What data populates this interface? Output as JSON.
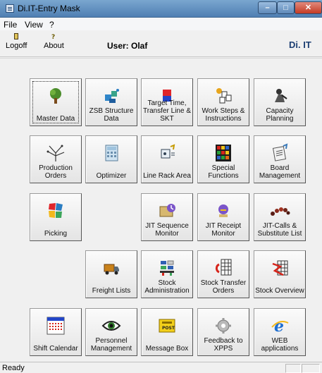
{
  "window": {
    "title": "Di.IT-Entry Mask"
  },
  "menu": {
    "items": [
      "File",
      "View",
      "?"
    ]
  },
  "toolbar": {
    "logoff_label": "Logoff",
    "about_label": "About",
    "user_text": "User:  Olaf",
    "logo_text": "Di. IT"
  },
  "tiles": [
    {
      "label": "Master Data",
      "icon": "tree-icon"
    },
    {
      "label": "ZSB Structure Data",
      "icon": "structure-icon"
    },
    {
      "label": "Target Time, Transfer Line & SKT",
      "icon": "target-time-icon"
    },
    {
      "label": "Work Steps & Instructions",
      "icon": "work-steps-icon"
    },
    {
      "label": "Capacity Planning",
      "icon": "capacity-icon"
    },
    {
      "label": "Production Orders",
      "icon": "production-tree-icon"
    },
    {
      "label": "Optimizer",
      "icon": "calculator-icon"
    },
    {
      "label": "Line Rack Area",
      "icon": "rack-icon"
    },
    {
      "label": "Special Functions",
      "icon": "rubiks-cube-icon"
    },
    {
      "label": "Board Management",
      "icon": "board-icon"
    },
    {
      "label": "Picking",
      "icon": "picking-icon"
    },
    {
      "label": "JIT Sequence Monitor",
      "icon": "jit-sequence-icon"
    },
    {
      "label": "JIT Receipt Monitor",
      "icon": "jit-receipt-icon"
    },
    {
      "label": "JIT-Calls & Substitute List",
      "icon": "jit-calls-icon"
    },
    {
      "label": "Freight Lists",
      "icon": "truck-icon"
    },
    {
      "label": "Stock Administration",
      "icon": "stock-admin-icon"
    },
    {
      "label": "Stock Transfer Orders",
      "icon": "stock-transfer-icon"
    },
    {
      "label": "Stock Overview",
      "icon": "stock-overview-icon"
    },
    {
      "label": "Shift Calendar",
      "icon": "calendar-icon"
    },
    {
      "label": "Personnel Management",
      "icon": "eye-icon"
    },
    {
      "label": "Message Box",
      "icon": "post-box-icon"
    },
    {
      "label": "Feedback to XPPS",
      "icon": "gear-icon"
    },
    {
      "label": "WEB applications",
      "icon": "browser-icon"
    }
  ],
  "status": {
    "text": "Ready"
  }
}
